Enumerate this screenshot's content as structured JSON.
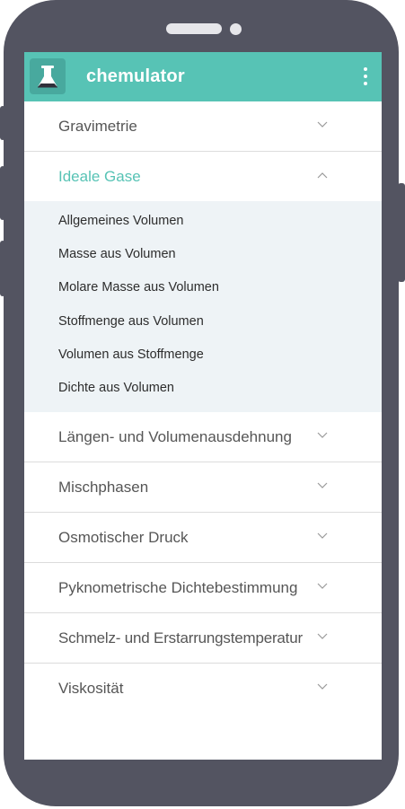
{
  "app": {
    "title": "chemulator"
  },
  "sections": [
    {
      "label": "Gravimetrie"
    },
    {
      "label": "Ideale Gase",
      "expanded": true
    },
    {
      "label": "Längen- und Volumenausdehnung"
    },
    {
      "label": "Mischphasen"
    },
    {
      "label": "Osmotischer Druck"
    },
    {
      "label": "Pyknometrische Dichtebestimmung"
    },
    {
      "label": "Schmelz- und Erstarrungstemperatur"
    },
    {
      "label": "Viskosität"
    }
  ],
  "ideale_gase_items": [
    {
      "label": "Allgemeines Volumen"
    },
    {
      "label": "Masse aus Volumen"
    },
    {
      "label": "Molare Masse aus Volumen"
    },
    {
      "label": "Stoffmenge aus Volumen"
    },
    {
      "label": "Volumen aus Stoffmenge"
    },
    {
      "label": "Dichte aus Volumen"
    }
  ],
  "colors": {
    "accent": "#57c3b5",
    "phone": "#535461",
    "submenu_bg": "#eef3f6"
  }
}
